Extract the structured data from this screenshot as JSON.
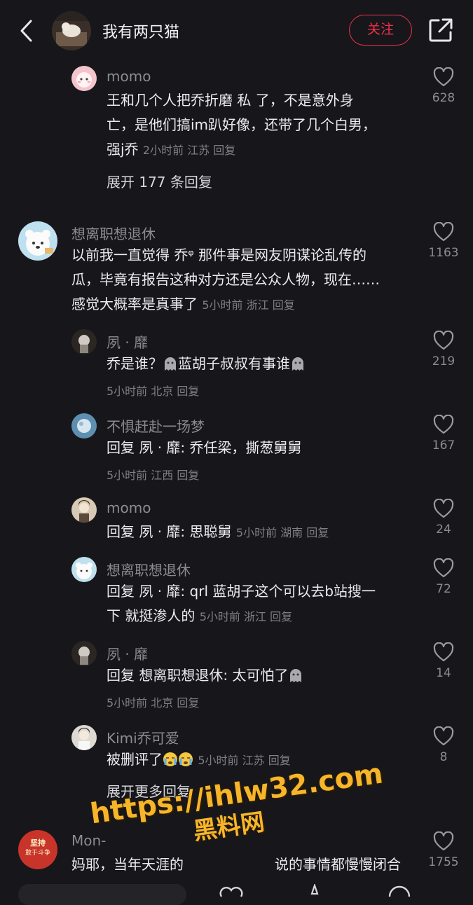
{
  "header": {
    "title": "我有两只猫",
    "follow_label": "关注"
  },
  "comments": [
    {
      "username": "momo",
      "lines": [
        "王和几个人把乔折磨 私 了，不是意外身",
        "亡，是他们搞im趴好像，还带了几个白男，"
      ],
      "last_line": "强j乔",
      "meta": "2小时前 江苏 回复",
      "likes": "628",
      "expand": "展开 177 条回复"
    },
    {
      "username": "想离职想退休",
      "lines": [
        "以前我一直觉得 乔ᵠ 那件事是网友阴谋论乱传的",
        "瓜，毕竟有报告这种对方还是公众人物，现在……"
      ],
      "last_line": "感觉大概率是真事了",
      "meta": "5小时前 浙江 回复",
      "likes": "1163"
    }
  ],
  "replies": [
    {
      "username": "夙 · 靡",
      "text_a": "乔是谁？",
      "text_b": "蓝胡子叔叔有事谁",
      "meta": "5小时前 北京 回复",
      "likes": "219"
    },
    {
      "username": "不惧赶赴一场梦",
      "text": "回复 夙 · 靡: 乔任梁，撕葱舅舅",
      "meta": "5小时前 江西 回复",
      "likes": "167"
    },
    {
      "username": "momo",
      "text": "回复 夙 · 靡: 思聪舅",
      "meta": "5小时前 湖南 回复",
      "likes": "24"
    },
    {
      "username": "想离职想退休",
      "text": "回复 夙 · 靡: qrl 蓝胡子这个可以去b站搜一",
      "text2": "下 就挺渗人的",
      "meta": "5小时前 浙江 回复",
      "likes": "72"
    },
    {
      "username": "夙 · 靡",
      "text": "回复 想离职想退休: 太可怕了",
      "meta": "5小时前 北京 回复",
      "likes": "14"
    },
    {
      "username": "Kimi乔可爱",
      "text": "被删评了",
      "meta": "5小时前 江苏 回复",
      "likes": "8"
    }
  ],
  "expand_more": "展开更多回复",
  "last_comment": {
    "avatar_text_1": "坚持",
    "avatar_text_2": "敢于斗争",
    "username": "Mon-",
    "text": "妈耶，当年天涯的",
    "text_tail": "说的事情都慢慢闭合",
    "likes": "1755"
  },
  "watermark": {
    "url": "https://ihlw32.com",
    "name": "黑料网"
  },
  "colors": {
    "background": "#17171b",
    "accent": "#f0304c",
    "watermark": "#f6b52a"
  }
}
